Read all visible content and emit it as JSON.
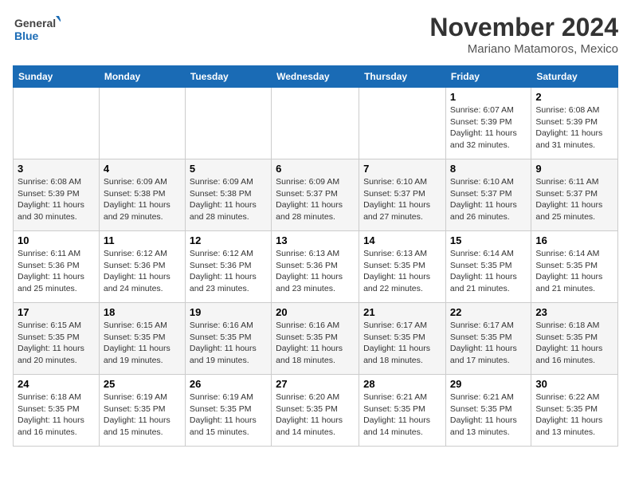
{
  "header": {
    "logo_line1": "General",
    "logo_line2": "Blue",
    "month": "November 2024",
    "location": "Mariano Matamoros, Mexico"
  },
  "weekdays": [
    "Sunday",
    "Monday",
    "Tuesday",
    "Wednesday",
    "Thursday",
    "Friday",
    "Saturday"
  ],
  "weeks": [
    [
      {
        "day": "",
        "info": ""
      },
      {
        "day": "",
        "info": ""
      },
      {
        "day": "",
        "info": ""
      },
      {
        "day": "",
        "info": ""
      },
      {
        "day": "",
        "info": ""
      },
      {
        "day": "1",
        "info": "Sunrise: 6:07 AM\nSunset: 5:39 PM\nDaylight: 11 hours and 32 minutes."
      },
      {
        "day": "2",
        "info": "Sunrise: 6:08 AM\nSunset: 5:39 PM\nDaylight: 11 hours and 31 minutes."
      }
    ],
    [
      {
        "day": "3",
        "info": "Sunrise: 6:08 AM\nSunset: 5:39 PM\nDaylight: 11 hours and 30 minutes."
      },
      {
        "day": "4",
        "info": "Sunrise: 6:09 AM\nSunset: 5:38 PM\nDaylight: 11 hours and 29 minutes."
      },
      {
        "day": "5",
        "info": "Sunrise: 6:09 AM\nSunset: 5:38 PM\nDaylight: 11 hours and 28 minutes."
      },
      {
        "day": "6",
        "info": "Sunrise: 6:09 AM\nSunset: 5:37 PM\nDaylight: 11 hours and 28 minutes."
      },
      {
        "day": "7",
        "info": "Sunrise: 6:10 AM\nSunset: 5:37 PM\nDaylight: 11 hours and 27 minutes."
      },
      {
        "day": "8",
        "info": "Sunrise: 6:10 AM\nSunset: 5:37 PM\nDaylight: 11 hours and 26 minutes."
      },
      {
        "day": "9",
        "info": "Sunrise: 6:11 AM\nSunset: 5:37 PM\nDaylight: 11 hours and 25 minutes."
      }
    ],
    [
      {
        "day": "10",
        "info": "Sunrise: 6:11 AM\nSunset: 5:36 PM\nDaylight: 11 hours and 25 minutes."
      },
      {
        "day": "11",
        "info": "Sunrise: 6:12 AM\nSunset: 5:36 PM\nDaylight: 11 hours and 24 minutes."
      },
      {
        "day": "12",
        "info": "Sunrise: 6:12 AM\nSunset: 5:36 PM\nDaylight: 11 hours and 23 minutes."
      },
      {
        "day": "13",
        "info": "Sunrise: 6:13 AM\nSunset: 5:36 PM\nDaylight: 11 hours and 23 minutes."
      },
      {
        "day": "14",
        "info": "Sunrise: 6:13 AM\nSunset: 5:35 PM\nDaylight: 11 hours and 22 minutes."
      },
      {
        "day": "15",
        "info": "Sunrise: 6:14 AM\nSunset: 5:35 PM\nDaylight: 11 hours and 21 minutes."
      },
      {
        "day": "16",
        "info": "Sunrise: 6:14 AM\nSunset: 5:35 PM\nDaylight: 11 hours and 21 minutes."
      }
    ],
    [
      {
        "day": "17",
        "info": "Sunrise: 6:15 AM\nSunset: 5:35 PM\nDaylight: 11 hours and 20 minutes."
      },
      {
        "day": "18",
        "info": "Sunrise: 6:15 AM\nSunset: 5:35 PM\nDaylight: 11 hours and 19 minutes."
      },
      {
        "day": "19",
        "info": "Sunrise: 6:16 AM\nSunset: 5:35 PM\nDaylight: 11 hours and 19 minutes."
      },
      {
        "day": "20",
        "info": "Sunrise: 6:16 AM\nSunset: 5:35 PM\nDaylight: 11 hours and 18 minutes."
      },
      {
        "day": "21",
        "info": "Sunrise: 6:17 AM\nSunset: 5:35 PM\nDaylight: 11 hours and 18 minutes."
      },
      {
        "day": "22",
        "info": "Sunrise: 6:17 AM\nSunset: 5:35 PM\nDaylight: 11 hours and 17 minutes."
      },
      {
        "day": "23",
        "info": "Sunrise: 6:18 AM\nSunset: 5:35 PM\nDaylight: 11 hours and 16 minutes."
      }
    ],
    [
      {
        "day": "24",
        "info": "Sunrise: 6:18 AM\nSunset: 5:35 PM\nDaylight: 11 hours and 16 minutes."
      },
      {
        "day": "25",
        "info": "Sunrise: 6:19 AM\nSunset: 5:35 PM\nDaylight: 11 hours and 15 minutes."
      },
      {
        "day": "26",
        "info": "Sunrise: 6:19 AM\nSunset: 5:35 PM\nDaylight: 11 hours and 15 minutes."
      },
      {
        "day": "27",
        "info": "Sunrise: 6:20 AM\nSunset: 5:35 PM\nDaylight: 11 hours and 14 minutes."
      },
      {
        "day": "28",
        "info": "Sunrise: 6:21 AM\nSunset: 5:35 PM\nDaylight: 11 hours and 14 minutes."
      },
      {
        "day": "29",
        "info": "Sunrise: 6:21 AM\nSunset: 5:35 PM\nDaylight: 11 hours and 13 minutes."
      },
      {
        "day": "30",
        "info": "Sunrise: 6:22 AM\nSunset: 5:35 PM\nDaylight: 11 hours and 13 minutes."
      }
    ]
  ]
}
